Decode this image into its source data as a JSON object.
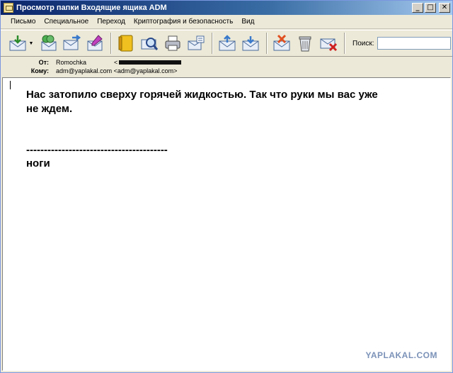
{
  "window": {
    "title": "Просмотр папки Входящие ящика ADM",
    "minimize": "_",
    "maximize": "□",
    "close": "✕"
  },
  "menu": {
    "items": [
      "Письмо",
      "Специальное",
      "Переход",
      "Криптография и безопасность",
      "Вид"
    ]
  },
  "toolbar": {
    "search_label": "Поиск:",
    "search_value": ""
  },
  "headers": {
    "from_label": "От:",
    "from_name": "Romochka",
    "from_address": "<",
    "to_label": "Кому:",
    "to_value": "adm@yaplakal.com <adm@yaplakal.com>"
  },
  "message": {
    "line1": "Нас затопило сверху горячей жидкостью. Так что руки мы вас уже",
    "line2": "не ждем.",
    "divider": "----------------------------------------",
    "signature": "ноги"
  },
  "watermark": "YAPLAKAL.COM"
}
